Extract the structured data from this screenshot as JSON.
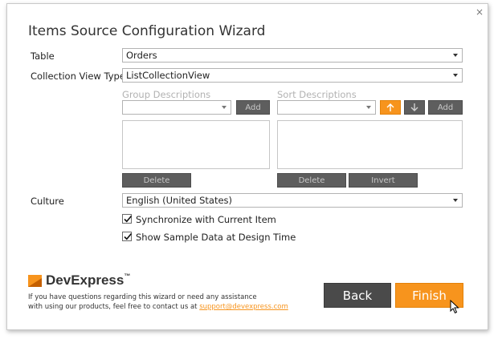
{
  "window": {
    "title": "Items Source Configuration Wizard",
    "close_glyph": "×"
  },
  "form": {
    "table_label": "Table",
    "table_value": "Orders",
    "collection_view_type_label": "Collection View Type",
    "collection_view_type_value": "ListCollectionView",
    "group_descriptions": {
      "label": "Group Descriptions",
      "combo_value": "",
      "add_label": "Add",
      "delete_label": "Delete"
    },
    "sort_descriptions": {
      "label": "Sort Descriptions",
      "combo_value": "",
      "add_label": "Add",
      "delete_label": "Delete",
      "invert_label": "Invert",
      "up_icon": "arrow-up-icon",
      "down_icon": "arrow-down-icon"
    },
    "culture_label": "Culture",
    "culture_value": "English (United States)",
    "sync_label": "Synchronize with Current Item",
    "sync_checked": true,
    "sample_label": "Show Sample Data at Design Time",
    "sample_checked": true
  },
  "footer": {
    "brand_dev": "Dev",
    "brand_express": "Express",
    "brand_tm": "™",
    "help_line1": "If you have questions regarding this wizard or need any assistance",
    "help_line2_prefix": "with using our products, feel free to contact us at",
    "support_email": "support@devexpress.com",
    "back_label": "Back",
    "finish_label": "Finish"
  },
  "colors": {
    "accent": "#f7941d",
    "dark_button": "#4a4a4a",
    "disabled_text": "#b2b2b2"
  }
}
